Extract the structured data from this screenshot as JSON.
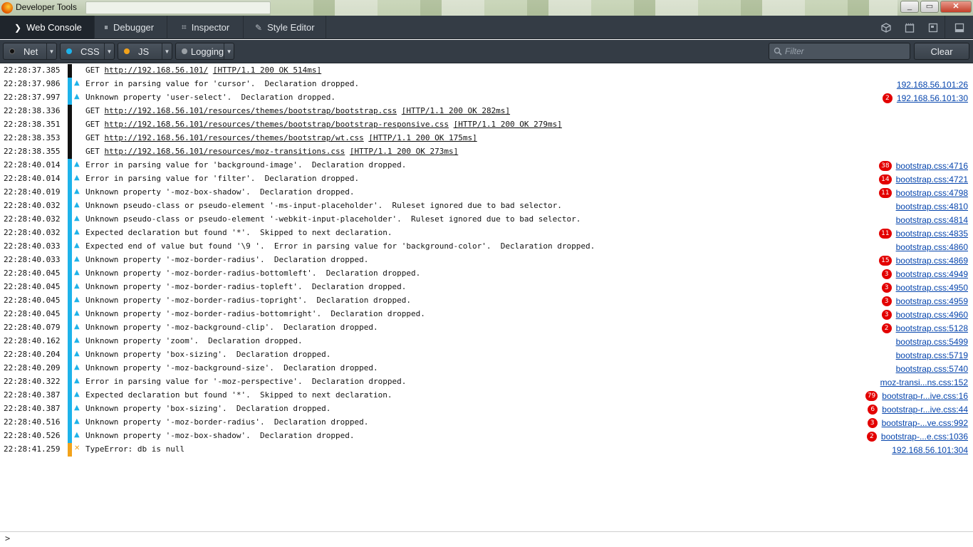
{
  "window": {
    "title": "Developer Tools",
    "controls": [
      "_",
      "▭",
      "✕"
    ]
  },
  "tabs": [
    {
      "label": "Web Console",
      "icon": "console-chevron-icon",
      "glyph": "❯",
      "active": true
    },
    {
      "label": "Debugger",
      "icon": "pause-icon",
      "glyph": "⏸",
      "active": false
    },
    {
      "label": "Inspector",
      "icon": "inspector-icon",
      "glyph": "⌗",
      "active": false
    },
    {
      "label": "Style Editor",
      "icon": "pencil-icon",
      "glyph": "✎",
      "active": false
    }
  ],
  "toolbar_icons": [
    "3d-view-icon",
    "responsive-icon",
    "scratchpad-icon",
    "dock-icon"
  ],
  "filters": [
    {
      "label": "Net",
      "dot_color": "#111111"
    },
    {
      "label": "CSS",
      "dot_color": "#1eb3ea"
    },
    {
      "label": "JS",
      "dot_color": "#f2a21b"
    },
    {
      "label": "Logging",
      "dot_color": "#9aa0a6"
    }
  ],
  "search": {
    "placeholder": "Filter"
  },
  "clear_label": "Clear",
  "colors": {
    "net": "#111111",
    "css": "#1eb3ea",
    "js": "#f2a21b",
    "badge": "#e30000",
    "link": "#0645ad"
  },
  "logs": [
    {
      "time": "22:28:37.385",
      "cat": "net",
      "method": "GET",
      "url": "http://192.168.56.101/",
      "status": "[HTTP/1.1 200 OK 514ms]"
    },
    {
      "time": "22:28:37.986",
      "cat": "css",
      "text": "Error in parsing value for 'cursor'.  Declaration dropped.",
      "loc": "192.168.56.101:26"
    },
    {
      "time": "22:28:37.997",
      "cat": "css",
      "text": "Unknown property 'user-select'.  Declaration dropped.",
      "count": "2",
      "loc": "192.168.56.101:30"
    },
    {
      "time": "22:28:38.336",
      "cat": "net",
      "method": "GET",
      "url": "http://192.168.56.101/resources/themes/bootstrap/bootstrap.css",
      "status": "[HTTP/1.1 200 OK 282ms]"
    },
    {
      "time": "22:28:38.351",
      "cat": "net",
      "method": "GET",
      "url": "http://192.168.56.101/resources/themes/bootstrap/bootstrap-responsive.css",
      "status": "[HTTP/1.1 200 OK 279ms]"
    },
    {
      "time": "22:28:38.353",
      "cat": "net",
      "method": "GET",
      "url": "http://192.168.56.101/resources/themes/bootstrap/wt.css",
      "status": "[HTTP/1.1 200 OK 175ms]"
    },
    {
      "time": "22:28:38.355",
      "cat": "net",
      "method": "GET",
      "url": "http://192.168.56.101/resources/moz-transitions.css",
      "status": "[HTTP/1.1 200 OK 273ms]"
    },
    {
      "time": "22:28:40.014",
      "cat": "css",
      "text": "Error in parsing value for 'background-image'.  Declaration dropped.",
      "count": "38",
      "loc": "bootstrap.css:4716"
    },
    {
      "time": "22:28:40.014",
      "cat": "css",
      "text": "Error in parsing value for 'filter'.  Declaration dropped.",
      "count": "14",
      "loc": "bootstrap.css:4721"
    },
    {
      "time": "22:28:40.019",
      "cat": "css",
      "text": "Unknown property '-moz-box-shadow'.  Declaration dropped.",
      "count": "11",
      "loc": "bootstrap.css:4798"
    },
    {
      "time": "22:28:40.032",
      "cat": "css",
      "text": "Unknown pseudo-class or pseudo-element '-ms-input-placeholder'.  Ruleset ignored due to bad selector.",
      "loc": "bootstrap.css:4810"
    },
    {
      "time": "22:28:40.032",
      "cat": "css",
      "text": "Unknown pseudo-class or pseudo-element '-webkit-input-placeholder'.  Ruleset ignored due to bad selector.",
      "loc": "bootstrap.css:4814"
    },
    {
      "time": "22:28:40.032",
      "cat": "css",
      "text": "Expected declaration but found '*'.  Skipped to next declaration.",
      "count": "11",
      "loc": "bootstrap.css:4835"
    },
    {
      "time": "22:28:40.033",
      "cat": "css",
      "text": "Expected end of value but found '\\9 '.  Error in parsing value for 'background-color'.  Declaration dropped.",
      "loc": "bootstrap.css:4860"
    },
    {
      "time": "22:28:40.033",
      "cat": "css",
      "text": "Unknown property '-moz-border-radius'.  Declaration dropped.",
      "count": "15",
      "loc": "bootstrap.css:4869"
    },
    {
      "time": "22:28:40.045",
      "cat": "css",
      "text": "Unknown property '-moz-border-radius-bottomleft'.  Declaration dropped.",
      "count": "3",
      "loc": "bootstrap.css:4949"
    },
    {
      "time": "22:28:40.045",
      "cat": "css",
      "text": "Unknown property '-moz-border-radius-topleft'.  Declaration dropped.",
      "count": "3",
      "loc": "bootstrap.css:4950"
    },
    {
      "time": "22:28:40.045",
      "cat": "css",
      "text": "Unknown property '-moz-border-radius-topright'.  Declaration dropped.",
      "count": "3",
      "loc": "bootstrap.css:4959"
    },
    {
      "time": "22:28:40.045",
      "cat": "css",
      "text": "Unknown property '-moz-border-radius-bottomright'.  Declaration dropped.",
      "count": "3",
      "loc": "bootstrap.css:4960"
    },
    {
      "time": "22:28:40.079",
      "cat": "css",
      "text": "Unknown property '-moz-background-clip'.  Declaration dropped.",
      "count": "2",
      "loc": "bootstrap.css:5128"
    },
    {
      "time": "22:28:40.162",
      "cat": "css",
      "text": "Unknown property 'zoom'.  Declaration dropped.",
      "loc": "bootstrap.css:5499"
    },
    {
      "time": "22:28:40.204",
      "cat": "css",
      "text": "Unknown property 'box-sizing'.  Declaration dropped.",
      "loc": "bootstrap.css:5719"
    },
    {
      "time": "22:28:40.209",
      "cat": "css",
      "text": "Unknown property '-moz-background-size'.  Declaration dropped.",
      "loc": "bootstrap.css:5740"
    },
    {
      "time": "22:28:40.322",
      "cat": "css",
      "text": "Error in parsing value for '-moz-perspective'.  Declaration dropped.",
      "loc": "moz-transi...ns.css:152"
    },
    {
      "time": "22:28:40.387",
      "cat": "css",
      "text": "Expected declaration but found '*'.  Skipped to next declaration.",
      "count": "79",
      "loc": "bootstrap-r...ive.css:16"
    },
    {
      "time": "22:28:40.387",
      "cat": "css",
      "text": "Unknown property 'box-sizing'.  Declaration dropped.",
      "count": "6",
      "loc": "bootstrap-r...ive.css:44"
    },
    {
      "time": "22:28:40.516",
      "cat": "css",
      "text": "Unknown property '-moz-border-radius'.  Declaration dropped.",
      "count": "3",
      "loc": "bootstrap-...ve.css:992"
    },
    {
      "time": "22:28:40.526",
      "cat": "css",
      "text": "Unknown property '-moz-box-shadow'.  Declaration dropped.",
      "count": "2",
      "loc": "bootstrap-...e.css:1036"
    },
    {
      "time": "22:28:41.259",
      "cat": "js",
      "text": "TypeError: db is null",
      "loc": "192.168.56.101:304"
    }
  ],
  "prompt": ">"
}
